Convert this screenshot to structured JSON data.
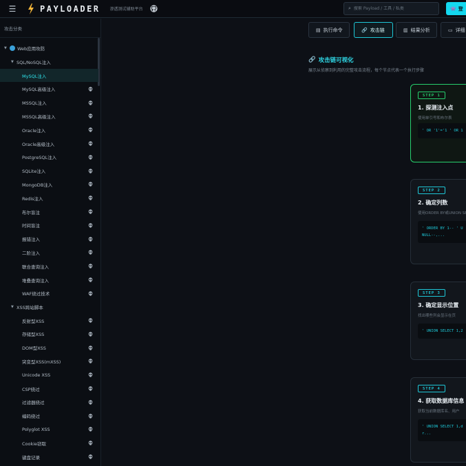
{
  "header": {
    "logo_text": "PAYLOADER",
    "tagline": "渗透测试辅助平台",
    "search_placeholder": "搜索 Payload / 工具 / 私类",
    "cta_label": "登"
  },
  "sidebar": {
    "title": "攻击分类",
    "groups": [
      {
        "label": "Web应用攻防",
        "expanded": true
      },
      {
        "label": "SQL/NoSQL注入",
        "expanded": true
      },
      {
        "label": "XSS跨站脚本",
        "expanded": true
      }
    ],
    "sql_items": [
      "MySQL注入",
      "MySQL高级注入",
      "MSSQL注入",
      "MSSQL高级注入",
      "Oracle注入",
      "Oracle高级注入",
      "PostgreSQL注入",
      "SQLite注入",
      "MongoDB注入",
      "Redis注入",
      "布尔盲注",
      "时间盲注",
      "报错注入",
      "二阶注入",
      "联合查询注入",
      "堆叠查询注入",
      "WAF绕过技术"
    ],
    "xss_items": [
      "反射型XSS",
      "存储型XSS",
      "DOM型XSS",
      "突变型XSS(mXSS)",
      "Unicode XSS",
      "CSP绕过",
      "过滤器绕过",
      "编码绕过",
      "Polyglot XSS",
      "Cookie窃取",
      "键盘记录"
    ],
    "active_item": "MySQL注入"
  },
  "tabs": [
    {
      "label": "执行命令",
      "icon": "terminal-icon"
    },
    {
      "label": "攻击链",
      "icon": "link-icon",
      "active": true
    },
    {
      "label": "结果分析",
      "icon": "chart-icon"
    },
    {
      "label": "详细",
      "icon": "book-icon"
    }
  ],
  "chain": {
    "title": "攻击链可视化",
    "description": "展示从侦察到利用的完整攻击流程，每个节点代表一个执行步骤"
  },
  "steps": [
    {
      "badge": "STEP 1",
      "title": "1. 探测注入点",
      "desc": "使用单引号和布尔表",
      "code": "' OR '1'='1 ' OR 1"
    },
    {
      "badge": "STEP 2",
      "title": "2. 确定列数",
      "desc": "使用ORDER BY或UNION SEL",
      "code": "' ORDER BY 1-- ' U\nNULL--,..."
    },
    {
      "badge": "STEP 3",
      "title": "3. 确定显示位置",
      "desc": "找出哪些列会显示在页",
      "code": "' UNION SELECT 1,2"
    },
    {
      "badge": "STEP 4",
      "title": "4. 获取数据库信息",
      "desc": "获取当前数据库名、用户",
      "code": "' UNION SELECT 1,d\nr..."
    }
  ],
  "colors": {
    "accent": "#1ec8d8",
    "success": "#27d06e",
    "background": "#0d1016"
  }
}
